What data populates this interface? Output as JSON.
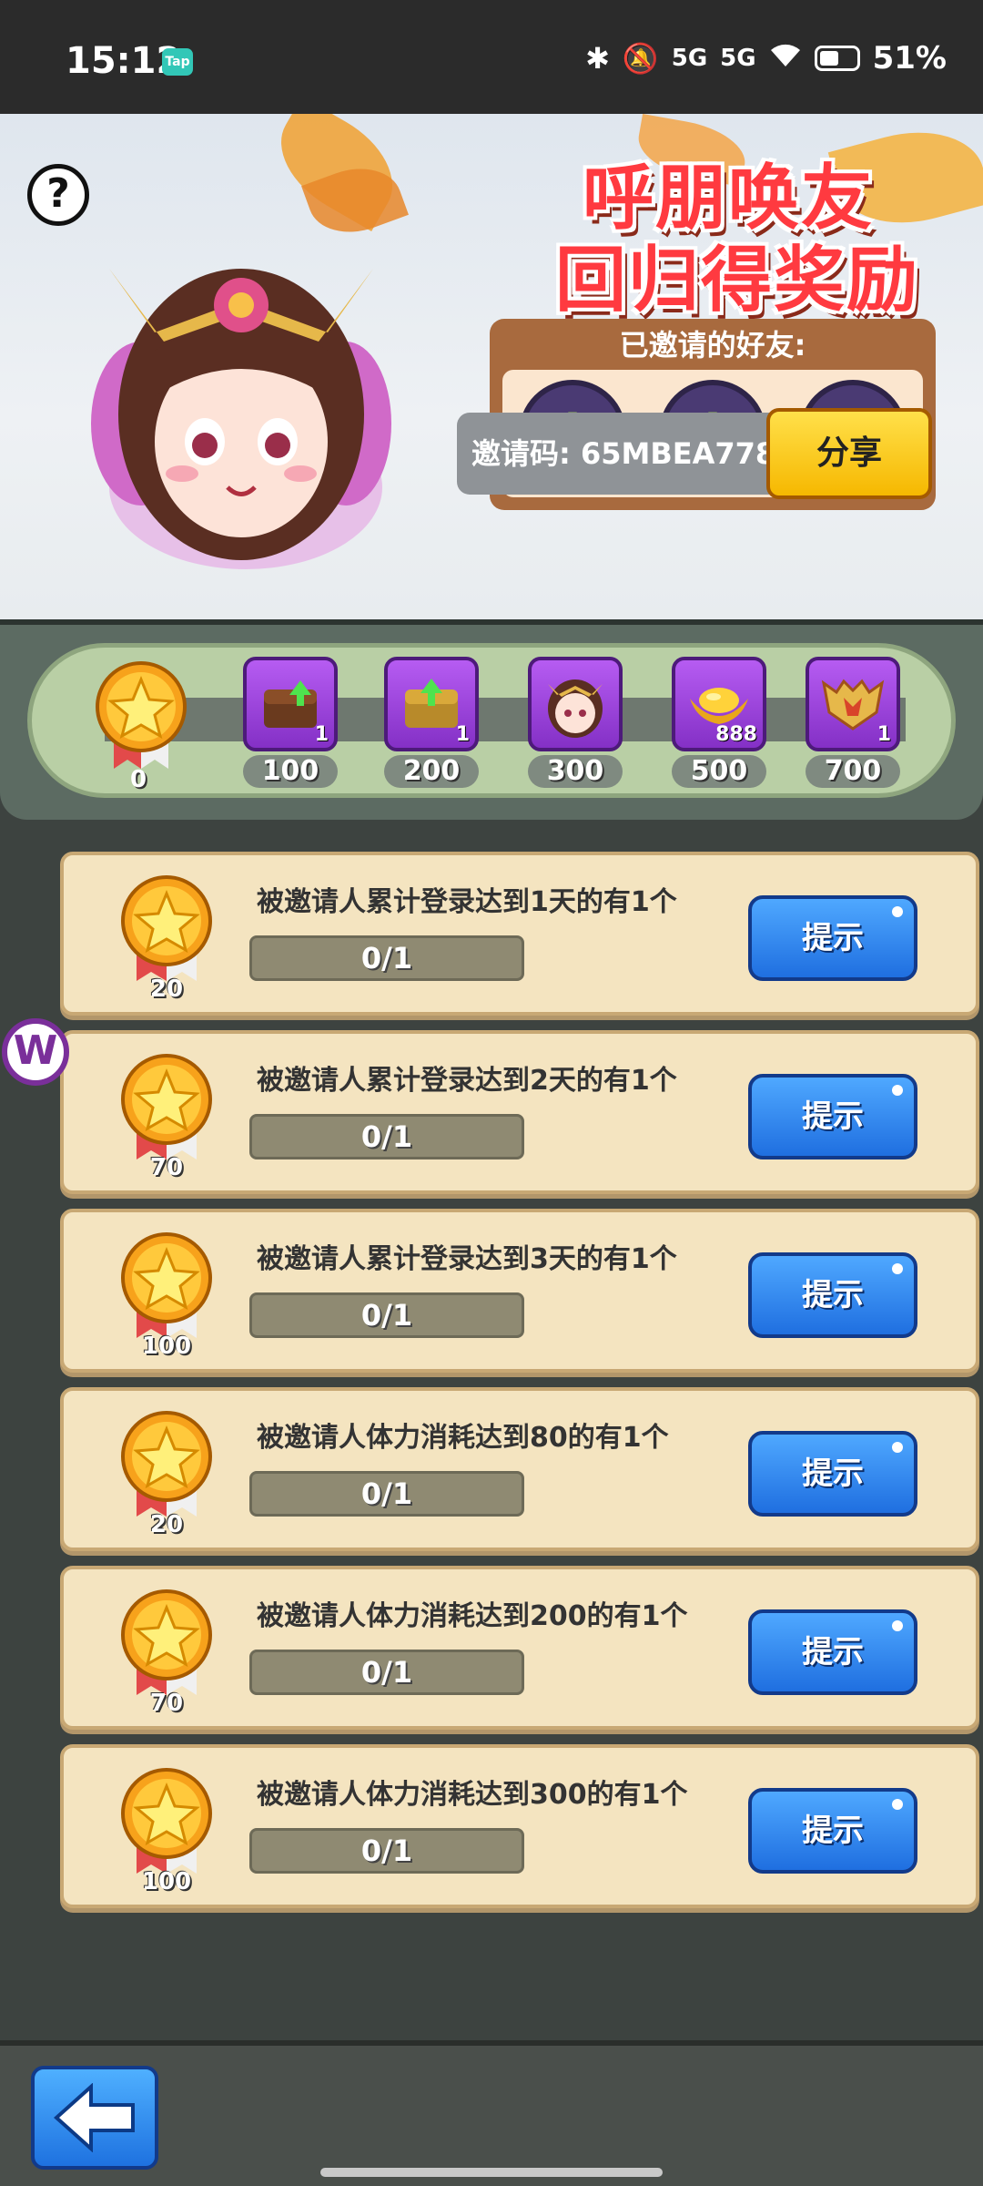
{
  "status_bar": {
    "time": "15:12",
    "app_badge": "Tap",
    "signal_1": "5G",
    "signal_2": "5G",
    "battery": "51%"
  },
  "banner": {
    "help": "?",
    "title_line1": "呼朋唤友",
    "title_line2": "回归得奖励",
    "invited_title": "已邀请的好友:",
    "invite_slots": [
      "+",
      "+",
      "+"
    ],
    "invite_code": "邀请码: 65MBEA778",
    "share_label": "分享"
  },
  "track": {
    "start_value": "0",
    "rewards": [
      {
        "icon": "chest-upgrade-icon",
        "count": "1",
        "label": "100"
      },
      {
        "icon": "chest-upgrade-icon",
        "count": "1",
        "label": "200"
      },
      {
        "icon": "hero-portrait-icon",
        "count": "",
        "label": "300"
      },
      {
        "icon": "gold-ingot-icon",
        "count": "888",
        "label": "500"
      },
      {
        "icon": "armor-icon",
        "count": "1",
        "label": "700"
      }
    ]
  },
  "tasks": [
    {
      "medal": "20",
      "desc": "被邀请人累计登录达到1天的有1个",
      "progress": "0/1",
      "button": "提示"
    },
    {
      "medal": "70",
      "desc": "被邀请人累计登录达到2天的有1个",
      "progress": "0/1",
      "button": "提示"
    },
    {
      "medal": "100",
      "desc": "被邀请人累计登录达到3天的有1个",
      "progress": "0/1",
      "button": "提示"
    },
    {
      "medal": "20",
      "desc": "被邀请人体力消耗达到80的有1个",
      "progress": "0/1",
      "button": "提示"
    },
    {
      "medal": "70",
      "desc": "被邀请人体力消耗达到200的有1个",
      "progress": "0/1",
      "button": "提示"
    },
    {
      "medal": "100",
      "desc": "被邀请人体力消耗达到300的有1个",
      "progress": "0/1",
      "button": "提示"
    }
  ],
  "floating": {
    "letter": "W"
  },
  "colors": {
    "title_red": "#ff3a40",
    "hint_blue": "#1f6fe0",
    "share_yellow": "#f6b800",
    "panel_cream": "#f4e4c0",
    "slot_purple": "#4a3a73"
  }
}
